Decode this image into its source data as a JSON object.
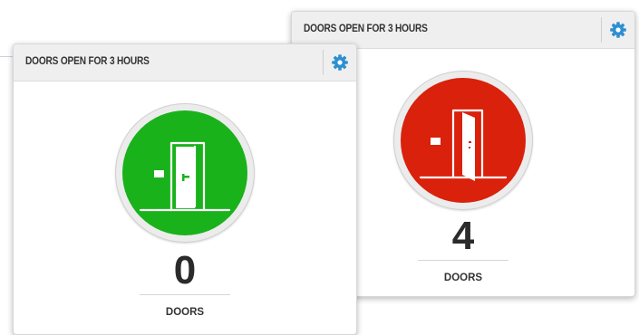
{
  "widgets": {
    "red": {
      "title": "DOORS OPEN FOR 3 HOURS",
      "count": "4",
      "unit": "DOORS",
      "status_color": "#d9210b",
      "icon": "door-open-icon"
    },
    "green": {
      "title": "DOORS OPEN FOR 3 HOURS",
      "count": "0",
      "unit": "DOORS",
      "status_color": "#19b21b",
      "icon": "door-closed-icon"
    }
  },
  "colors": {
    "gear": "#2e8fd0",
    "header_bg": "#efefef"
  },
  "icons": {
    "settings": "gear-icon"
  }
}
